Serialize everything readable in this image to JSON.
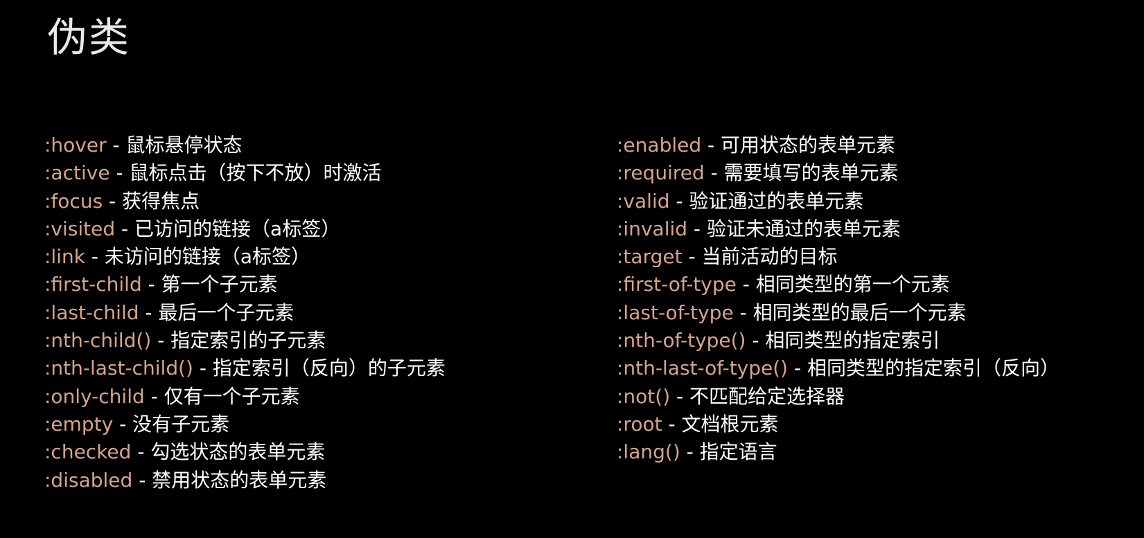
{
  "title": "伪类",
  "colors": {
    "background": "#000000",
    "selector": "#d6a48c",
    "description": "#ffffff",
    "title": "#e9e9e9"
  },
  "left_column": [
    {
      "selector": ":hover",
      "description": "鼠标悬停状态"
    },
    {
      "selector": ":active",
      "description": "鼠标点击（按下不放）时激活"
    },
    {
      "selector": ":focus",
      "description": "获得焦点"
    },
    {
      "selector": ":visited",
      "description": "已访问的链接（a标签）"
    },
    {
      "selector": ":link",
      "description": "未访问的链接（a标签）"
    },
    {
      "selector": ":first-child",
      "description": "第一个子元素"
    },
    {
      "selector": ":last-child",
      "description": "最后一个子元素"
    },
    {
      "selector": ":nth-child()",
      "description": "指定索引的子元素"
    },
    {
      "selector": ":nth-last-child()",
      "description": "指定索引（反向）的子元素"
    },
    {
      "selector": ":only-child",
      "description": "仅有一个子元素"
    },
    {
      "selector": ":empty",
      "description": "没有子元素"
    },
    {
      "selector": ":checked",
      "description": "勾选状态的表单元素"
    },
    {
      "selector": ":disabled",
      "description": "禁用状态的表单元素"
    }
  ],
  "right_column": [
    {
      "selector": ":enabled",
      "description": "可用状态的表单元素"
    },
    {
      "selector": ":required",
      "description": "需要填写的表单元素"
    },
    {
      "selector": ":valid",
      "description": "验证通过的表单元素"
    },
    {
      "selector": ":invalid",
      "description": "验证未通过的表单元素"
    },
    {
      "selector": ":target",
      "description": "当前活动的目标"
    },
    {
      "selector": ":first-of-type",
      "description": "相同类型的第一个元素"
    },
    {
      "selector": ":last-of-type",
      "description": "相同类型的最后一个元素"
    },
    {
      "selector": ":nth-of-type()",
      "description": "相同类型的指定索引"
    },
    {
      "selector": ":nth-last-of-type()",
      "description": "相同类型的指定索引（反向）"
    },
    {
      "selector": ":not()",
      "description": "不匹配给定选择器"
    },
    {
      "selector": ":root",
      "description": "文档根元素"
    },
    {
      "selector": ":lang()",
      "description": "指定语言"
    }
  ]
}
